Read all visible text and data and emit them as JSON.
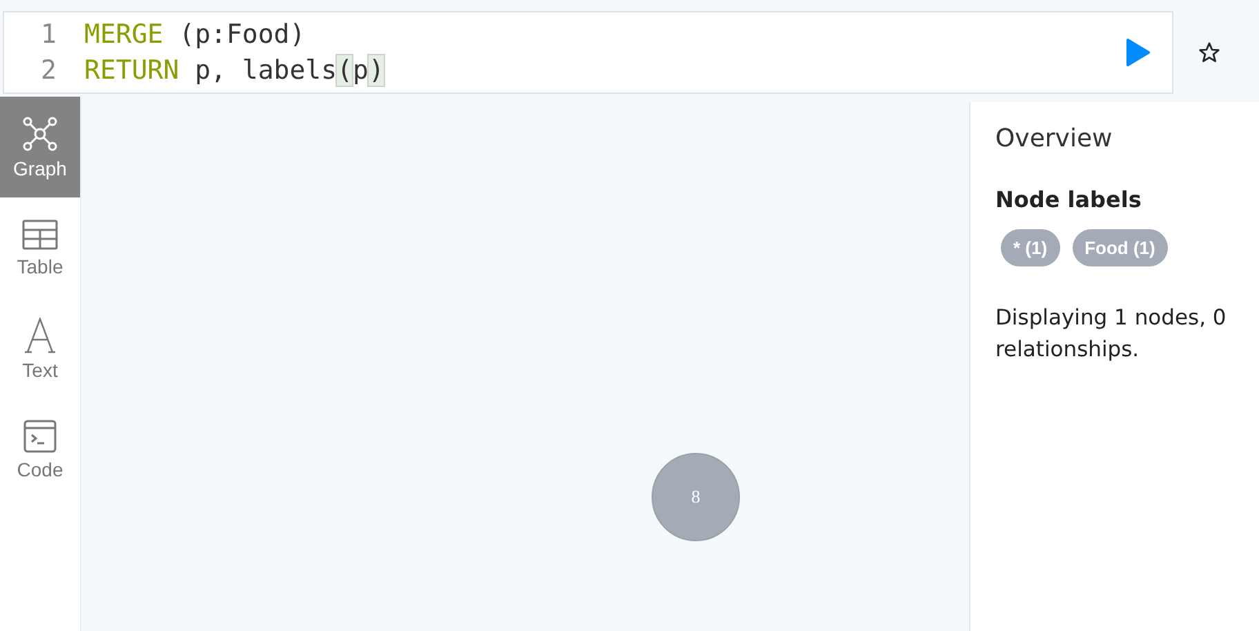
{
  "editor": {
    "lines": [
      {
        "number": "1",
        "tokens": [
          {
            "kind": "keyword",
            "text": "MERGE"
          },
          {
            "kind": "plain",
            "text": " (p:Food)"
          }
        ]
      },
      {
        "number": "2",
        "tokens": [
          {
            "kind": "keyword",
            "text": "RETURN"
          },
          {
            "kind": "plain",
            "text": " p, labels"
          },
          {
            "kind": "match",
            "text": "("
          },
          {
            "kind": "plain",
            "text": "p"
          },
          {
            "kind": "match",
            "text": ")"
          }
        ]
      }
    ]
  },
  "sidebar": {
    "items": [
      {
        "label": "Graph",
        "kind": "graph",
        "selected": true
      },
      {
        "label": "Table",
        "kind": "table",
        "selected": false
      },
      {
        "label": "Text",
        "kind": "text",
        "selected": false
      },
      {
        "label": "Code",
        "kind": "code",
        "selected": false
      }
    ]
  },
  "graph": {
    "nodes": [
      {
        "caption": "8"
      }
    ]
  },
  "overview": {
    "title": "Overview",
    "section": "Node labels",
    "labels": [
      "* (1)",
      "Food (1)"
    ],
    "summary": "Displaying 1 nodes, 0 relationships."
  }
}
